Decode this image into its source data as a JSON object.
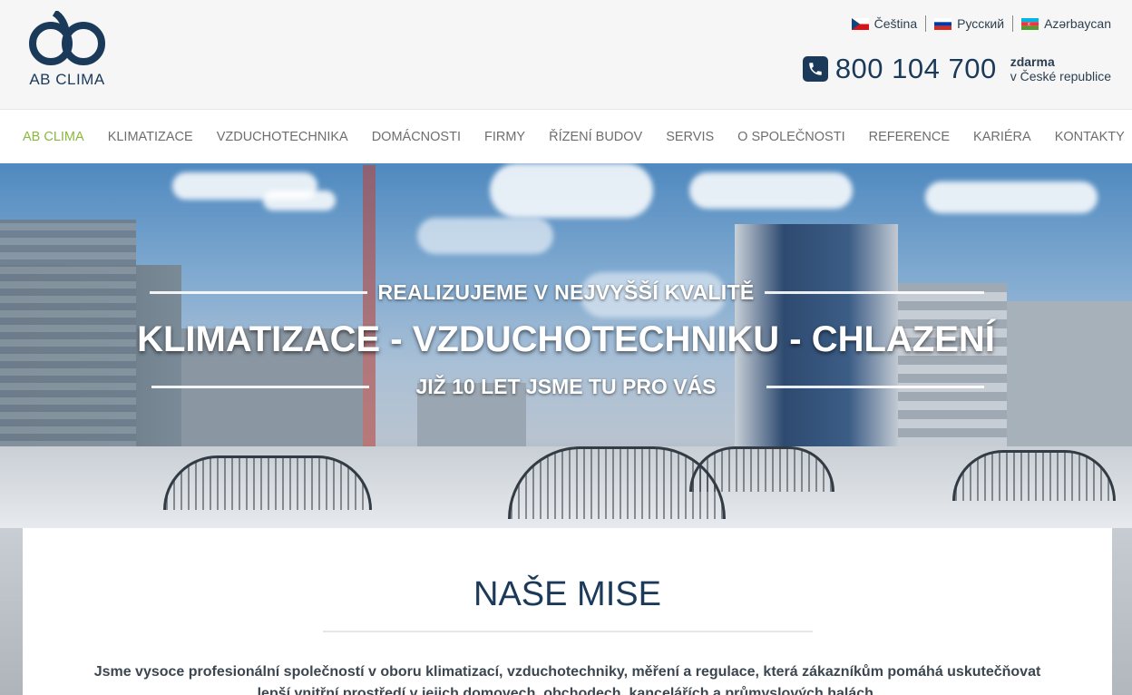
{
  "logo": {
    "text": "AB CLIMA",
    "color": "#1b3a5a"
  },
  "languages": [
    {
      "label": "Čeština",
      "flag": "czech-flag-icon"
    },
    {
      "label": "Русский",
      "flag": "russian-flag-icon"
    },
    {
      "label": "Azərbaycan",
      "flag": "azerbaijan-flag-icon"
    }
  ],
  "phone": {
    "number": "800 104 700",
    "note_bold": "zdarma",
    "note": "v České republice",
    "icon": "phone-icon"
  },
  "nav": {
    "items": [
      {
        "label": "AB CLIMA",
        "active": true
      },
      {
        "label": "KLIMATIZACE"
      },
      {
        "label": "VZDUCHOTECHNIKA"
      },
      {
        "label": "DOMÁCNOSTI"
      },
      {
        "label": "FIRMY"
      },
      {
        "label": "ŘÍZENÍ BUDOV"
      },
      {
        "label": "SERVIS"
      },
      {
        "label": "O SPOLEČNOSTI"
      },
      {
        "label": "REFERENCE"
      },
      {
        "label": "KARIÉRA"
      },
      {
        "label": "KONTAKTY"
      }
    ],
    "active_color": "#8ab83f"
  },
  "hero": {
    "top": "REALIZUJEME V NEJVYŠŠÍ KVALITĚ",
    "main": "KLIMATIZACE - VZDUCHOTECHNIKU - CHLAZENÍ",
    "sub": "JIŽ 10 LET JSME TU PRO VÁS"
  },
  "mission": {
    "title": "NAŠE MISE",
    "text": "Jsme vysoce profesionální společností v oboru klimatizací, vzduchotechniky, měření a regulace, která zákazníkům pomáhá uskutečňovat lepší vnitřní prostředí v jejich domovech, obchodech, kancelářích a průmyslových halách."
  }
}
